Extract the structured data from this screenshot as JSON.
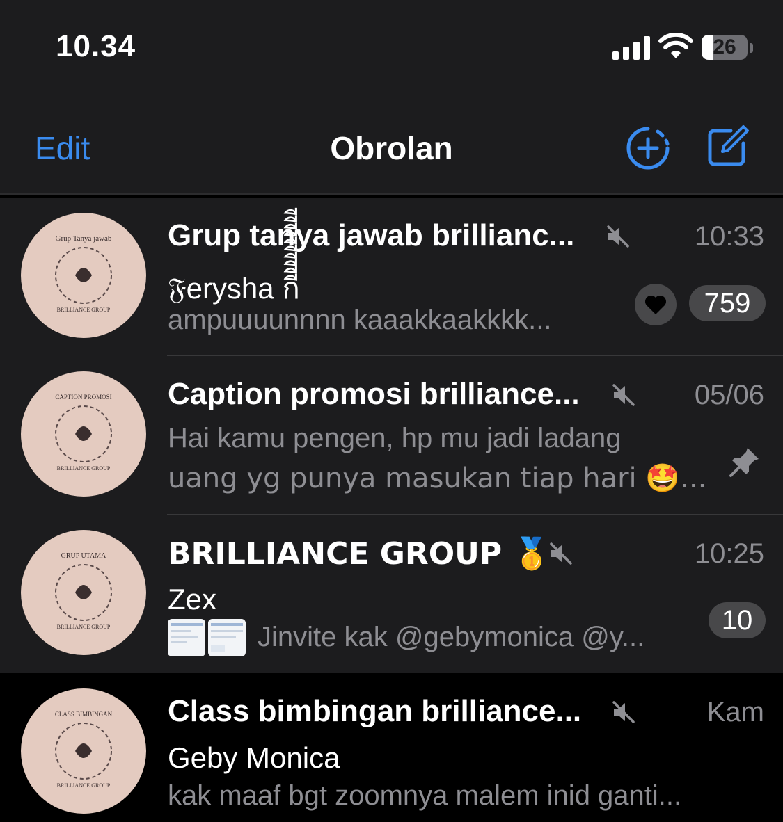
{
  "status_bar": {
    "time": "10.34",
    "battery": "26",
    "battery_level": 0.26
  },
  "nav": {
    "edit_label": "Edit",
    "title": "Obrolan"
  },
  "accent_color": "#3a8bef",
  "chats": [
    {
      "name": "Grup tanya jawab brillianc...",
      "time": "10:33",
      "sender": "𝔉erysha กีีีีีีีีีี",
      "preview": "ampuuuunnnn kaaakkaakkkk...",
      "unread": "759",
      "avatar_top_text": "Grup Tanya jawab",
      "avatar_bottom_text": "BRILLIANCE GROUP",
      "muted": true
    },
    {
      "name": "Caption promosi brilliance...",
      "time": "05/06",
      "preview_line1": "Hai kamu pengen, hp mu jadi ladang",
      "preview_line2": "uang yg punya masukan tiap hari 🤩...",
      "avatar_top_text": "CAPTION PROMOSI",
      "avatar_bottom_text": "BRILLIANCE GROUP",
      "muted": true,
      "pinned": true
    },
    {
      "name": "BRILLIANCE GROUP 🥇",
      "time": "10:25",
      "sender": "Zex",
      "preview": "Jinvite kak @gebymonica @y...",
      "unread": "10",
      "avatar_top_text": "GRUP UTAMA",
      "avatar_bottom_text": "BRILLIANCE GROUP",
      "muted": true
    },
    {
      "name": "Class bimbingan brilliance...",
      "time": "Kam",
      "sender": "Geby Monica",
      "preview": "kak maaf bgt zoomnya malem inid ganti...",
      "avatar_top_text": "CLASS BIMBINGAN",
      "avatar_bottom_text": "BRILLIANCE GROUP",
      "muted": true
    }
  ]
}
